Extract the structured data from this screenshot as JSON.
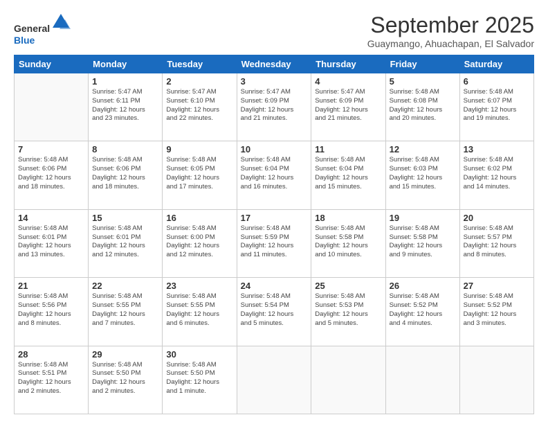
{
  "header": {
    "logo_general": "General",
    "logo_blue": "Blue",
    "month_title": "September 2025",
    "location": "Guaymango, Ahuachapan, El Salvador"
  },
  "weekdays": [
    "Sunday",
    "Monday",
    "Tuesday",
    "Wednesday",
    "Thursday",
    "Friday",
    "Saturday"
  ],
  "weeks": [
    [
      {
        "day": "",
        "info": ""
      },
      {
        "day": "1",
        "info": "Sunrise: 5:47 AM\nSunset: 6:11 PM\nDaylight: 12 hours\nand 23 minutes."
      },
      {
        "day": "2",
        "info": "Sunrise: 5:47 AM\nSunset: 6:10 PM\nDaylight: 12 hours\nand 22 minutes."
      },
      {
        "day": "3",
        "info": "Sunrise: 5:47 AM\nSunset: 6:09 PM\nDaylight: 12 hours\nand 21 minutes."
      },
      {
        "day": "4",
        "info": "Sunrise: 5:47 AM\nSunset: 6:09 PM\nDaylight: 12 hours\nand 21 minutes."
      },
      {
        "day": "5",
        "info": "Sunrise: 5:48 AM\nSunset: 6:08 PM\nDaylight: 12 hours\nand 20 minutes."
      },
      {
        "day": "6",
        "info": "Sunrise: 5:48 AM\nSunset: 6:07 PM\nDaylight: 12 hours\nand 19 minutes."
      }
    ],
    [
      {
        "day": "7",
        "info": "Sunrise: 5:48 AM\nSunset: 6:06 PM\nDaylight: 12 hours\nand 18 minutes."
      },
      {
        "day": "8",
        "info": "Sunrise: 5:48 AM\nSunset: 6:06 PM\nDaylight: 12 hours\nand 18 minutes."
      },
      {
        "day": "9",
        "info": "Sunrise: 5:48 AM\nSunset: 6:05 PM\nDaylight: 12 hours\nand 17 minutes."
      },
      {
        "day": "10",
        "info": "Sunrise: 5:48 AM\nSunset: 6:04 PM\nDaylight: 12 hours\nand 16 minutes."
      },
      {
        "day": "11",
        "info": "Sunrise: 5:48 AM\nSunset: 6:04 PM\nDaylight: 12 hours\nand 15 minutes."
      },
      {
        "day": "12",
        "info": "Sunrise: 5:48 AM\nSunset: 6:03 PM\nDaylight: 12 hours\nand 15 minutes."
      },
      {
        "day": "13",
        "info": "Sunrise: 5:48 AM\nSunset: 6:02 PM\nDaylight: 12 hours\nand 14 minutes."
      }
    ],
    [
      {
        "day": "14",
        "info": "Sunrise: 5:48 AM\nSunset: 6:01 PM\nDaylight: 12 hours\nand 13 minutes."
      },
      {
        "day": "15",
        "info": "Sunrise: 5:48 AM\nSunset: 6:01 PM\nDaylight: 12 hours\nand 12 minutes."
      },
      {
        "day": "16",
        "info": "Sunrise: 5:48 AM\nSunset: 6:00 PM\nDaylight: 12 hours\nand 12 minutes."
      },
      {
        "day": "17",
        "info": "Sunrise: 5:48 AM\nSunset: 5:59 PM\nDaylight: 12 hours\nand 11 minutes."
      },
      {
        "day": "18",
        "info": "Sunrise: 5:48 AM\nSunset: 5:58 PM\nDaylight: 12 hours\nand 10 minutes."
      },
      {
        "day": "19",
        "info": "Sunrise: 5:48 AM\nSunset: 5:58 PM\nDaylight: 12 hours\nand 9 minutes."
      },
      {
        "day": "20",
        "info": "Sunrise: 5:48 AM\nSunset: 5:57 PM\nDaylight: 12 hours\nand 8 minutes."
      }
    ],
    [
      {
        "day": "21",
        "info": "Sunrise: 5:48 AM\nSunset: 5:56 PM\nDaylight: 12 hours\nand 8 minutes."
      },
      {
        "day": "22",
        "info": "Sunrise: 5:48 AM\nSunset: 5:55 PM\nDaylight: 12 hours\nand 7 minutes."
      },
      {
        "day": "23",
        "info": "Sunrise: 5:48 AM\nSunset: 5:55 PM\nDaylight: 12 hours\nand 6 minutes."
      },
      {
        "day": "24",
        "info": "Sunrise: 5:48 AM\nSunset: 5:54 PM\nDaylight: 12 hours\nand 5 minutes."
      },
      {
        "day": "25",
        "info": "Sunrise: 5:48 AM\nSunset: 5:53 PM\nDaylight: 12 hours\nand 5 minutes."
      },
      {
        "day": "26",
        "info": "Sunrise: 5:48 AM\nSunset: 5:52 PM\nDaylight: 12 hours\nand 4 minutes."
      },
      {
        "day": "27",
        "info": "Sunrise: 5:48 AM\nSunset: 5:52 PM\nDaylight: 12 hours\nand 3 minutes."
      }
    ],
    [
      {
        "day": "28",
        "info": "Sunrise: 5:48 AM\nSunset: 5:51 PM\nDaylight: 12 hours\nand 2 minutes."
      },
      {
        "day": "29",
        "info": "Sunrise: 5:48 AM\nSunset: 5:50 PM\nDaylight: 12 hours\nand 2 minutes."
      },
      {
        "day": "30",
        "info": "Sunrise: 5:48 AM\nSunset: 5:50 PM\nDaylight: 12 hours\nand 1 minute."
      },
      {
        "day": "",
        "info": ""
      },
      {
        "day": "",
        "info": ""
      },
      {
        "day": "",
        "info": ""
      },
      {
        "day": "",
        "info": ""
      }
    ]
  ]
}
